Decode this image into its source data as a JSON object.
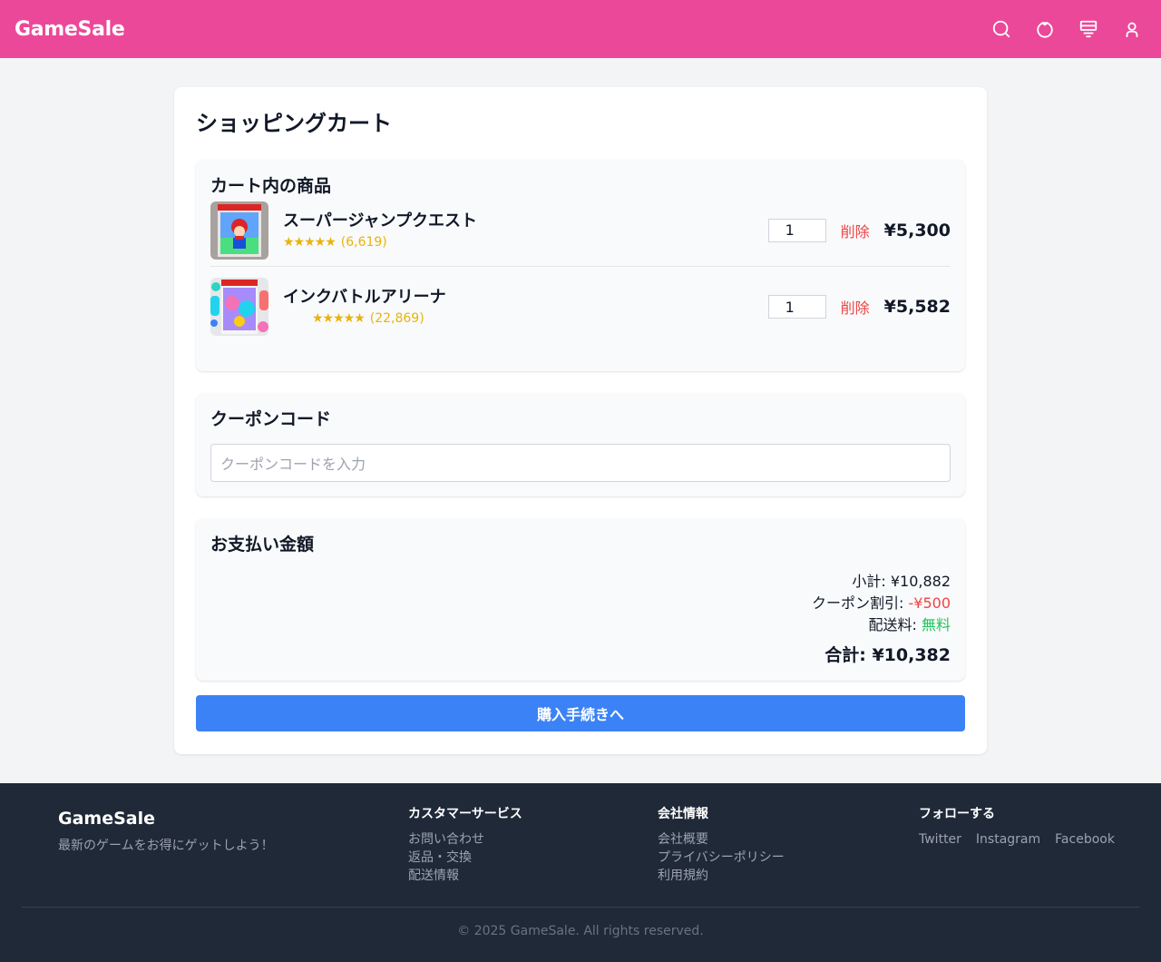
{
  "header": {
    "logo": "GameSale",
    "icons": [
      "search-icon",
      "circle-icon",
      "cart-icon",
      "user-icon"
    ]
  },
  "cart": {
    "title": "ショッピングカート",
    "items_title": "カート内の商品",
    "delete_label": "削除",
    "items": [
      {
        "name": "スーパージャンプクエスト",
        "stars": "★★★★★",
        "reviews": "(6,619)",
        "quantity": "1",
        "price": "¥5,300"
      },
      {
        "name": "インクバトルアリーナ",
        "stars": "★★★★★",
        "reviews": "(22,869)",
        "quantity": "1",
        "price": "¥5,582"
      }
    ]
  },
  "coupon": {
    "title": "クーポンコード",
    "placeholder": "クーポンコードを入力"
  },
  "payment": {
    "title": "お支払い金額",
    "subtotal_label": "小計: ",
    "subtotal": "¥10,882",
    "discount_label": "クーポン割引: ",
    "discount": "-¥500",
    "shipping_label": "配送料: ",
    "shipping": "無料",
    "total_label": "合計: ",
    "total": "¥10,382",
    "checkout_label": "購入手続きへ"
  },
  "footer": {
    "brand": "GameSale",
    "tagline": "最新のゲームをお得にゲットしよう！",
    "customer_service": {
      "title": "カスタマーサービス",
      "links": [
        "お問い合わせ",
        "返品・交換",
        "配送情報"
      ]
    },
    "company": {
      "title": "会社情報",
      "links": [
        "会社概要",
        "プライバシーポリシー",
        "利用規約"
      ]
    },
    "follow": {
      "title": "フォローする",
      "links": [
        "Twitter",
        "Instagram",
        "Facebook"
      ]
    },
    "copyright": "© 2025 GameSale. All rights reserved."
  },
  "colors": {
    "header": "#ec4899",
    "primary": "#3b82f6",
    "danger": "#ef4444",
    "success": "#22c55e",
    "star": "#eab308",
    "footer": "#1f2937"
  }
}
